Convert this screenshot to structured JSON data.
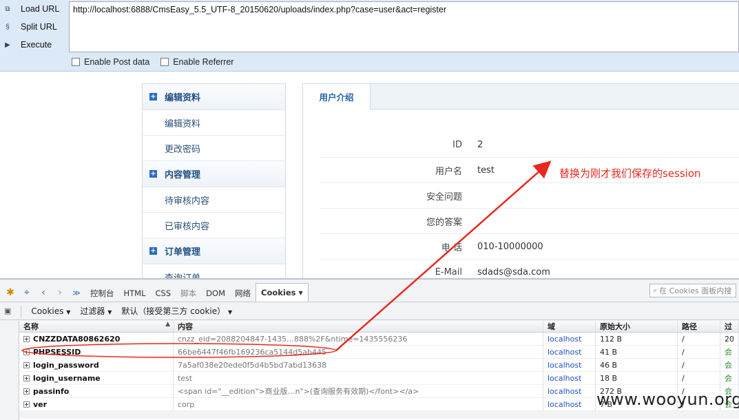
{
  "hackbar": {
    "load_url": "Load URL",
    "split_url": "Split URL",
    "execute": "Execute",
    "url": "http://localhost:6888/CmsEasy_5.5_UTF-8_20150620/uploads/index.php?case=user&act=register",
    "enable_post": "Enable Post data",
    "enable_referrer": "Enable Referrer"
  },
  "sidebar": {
    "sections": [
      {
        "title": "编辑资料",
        "items": [
          "编辑资料",
          "更改密码"
        ]
      },
      {
        "title": "内容管理",
        "items": [
          "待审核内容",
          "已审核内容"
        ]
      },
      {
        "title": "订单管理",
        "items": [
          "查询订单"
        ]
      }
    ]
  },
  "content": {
    "tab": "用户介绍",
    "rows": [
      {
        "label": "ID",
        "value": "2"
      },
      {
        "label": "用户名",
        "value": "test"
      },
      {
        "label": "安全问题",
        "value": ""
      },
      {
        "label": "您的答案",
        "value": ""
      },
      {
        "label": "电 话",
        "value": "010-10000000"
      },
      {
        "label": "E-Mail",
        "value": "sdads@sda.com"
      }
    ]
  },
  "annotation": "替换为刚才我们保存的session",
  "devtools": {
    "tabs": [
      "控制台",
      "HTML",
      "CSS",
      "脚本",
      "DOM",
      "网络",
      "Cookies"
    ],
    "search_placeholder": "在 Cookies 面板内搜",
    "sub": {
      "cookies": "Cookies",
      "filter": "过滤器",
      "default": "默认（接受第三方 cookie）"
    },
    "columns": [
      "名称",
      "内容",
      "域",
      "原始大小",
      "路径",
      "过"
    ],
    "cookies": [
      {
        "name": "CNZZDATA80862620",
        "value": "cnzz_eid=2088204847-1435…888%2F&ntime=1435556236",
        "domain": "localhost",
        "size": "112 B",
        "path": "/",
        "exp": "20"
      },
      {
        "name": "PHPSESSID",
        "value": "66be6447f46fb169236ca5144d5ab445",
        "domain": "localhost",
        "size": "41 B",
        "path": "/",
        "exp": "会"
      },
      {
        "name": "login_password",
        "value": "7a5af038e20ede0f5d4b5bd7abd13638",
        "domain": "localhost",
        "size": "46 B",
        "path": "/",
        "exp": "会"
      },
      {
        "name": "login_username",
        "value": "test",
        "domain": "localhost",
        "size": "18 B",
        "path": "/",
        "exp": "会"
      },
      {
        "name": "passinfo",
        "value": "<span id=\"__edition\">商业版…n\">(查询服务有效期)</font></a>",
        "domain": "localhost",
        "size": "272 B",
        "path": "/",
        "exp": "会"
      },
      {
        "name": "ver",
        "value": "corp",
        "domain": "localhost",
        "size": "7 B",
        "path": "/",
        "exp": "会"
      }
    ]
  },
  "watermark": "www.wooyun.org",
  "colors": {
    "accent_red": "#e8281e",
    "link_blue": "#1f4fc4",
    "hackbar_bg": "#dce9f6"
  }
}
